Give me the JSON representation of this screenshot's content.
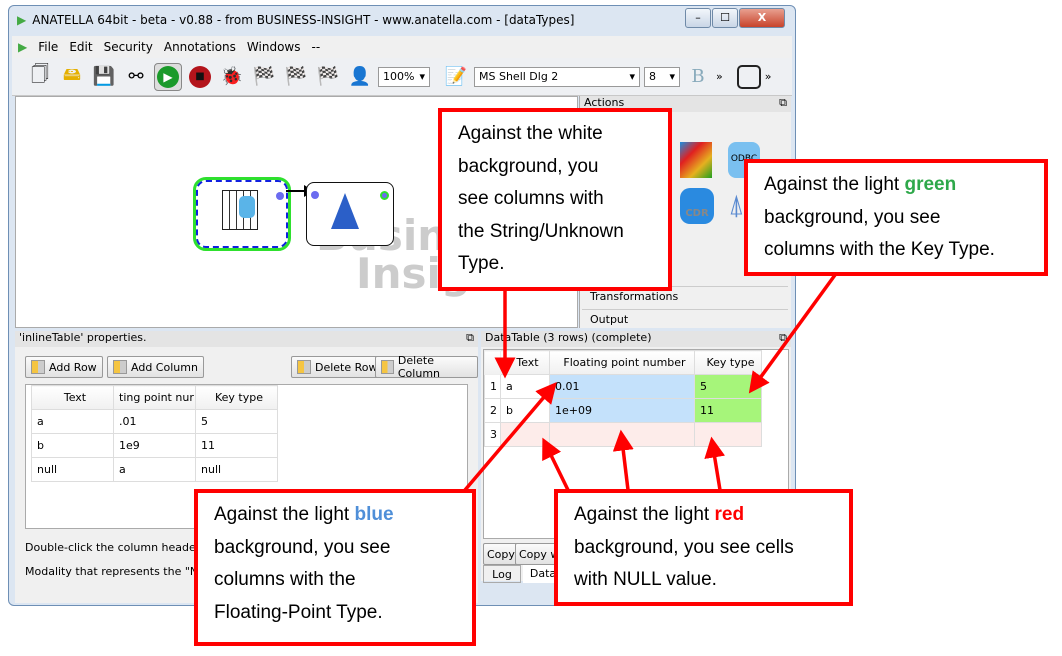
{
  "window": {
    "title": "ANATELLA 64bit - beta - v0.88 - from BUSINESS-INSIGHT - www.anatella.com - [dataTypes]",
    "minimize": "–",
    "maximize": "☐",
    "close": "X"
  },
  "menu": [
    "File",
    "Edit",
    "Security",
    "Annotations",
    "Windows",
    "--"
  ],
  "toolbar": {
    "zoom": "100%",
    "font": "MS Shell Dlg 2",
    "font_size": "8",
    "bold": "B",
    "more": "»"
  },
  "canvas": {
    "watermark_line1": "Business",
    "watermark_line2": "Insight"
  },
  "actions": {
    "title": "Actions",
    "icon_odbc": "ODBC",
    "icon_cdr": "CDR",
    "item_transformations": "Transformations",
    "item_output": "Output"
  },
  "properties": {
    "title": "'inlineTable' properties.",
    "add_row": "Add Row",
    "add_column": "Add Column",
    "delete_row": "Delete Row",
    "delete_column": "Delete Column",
    "columns": [
      "Text",
      "ting point nur",
      "Key type"
    ],
    "rows": [
      [
        "a",
        ".01",
        "5"
      ],
      [
        "b",
        "1e9",
        "11"
      ],
      [
        "null",
        "a",
        "null"
      ]
    ],
    "hint": "Double-click the column header to ch",
    "null_label": "Modality that represents the \"NULL\":"
  },
  "datatable": {
    "title": "DataTable (3 rows) (complete)",
    "columns": [
      "Text",
      "Floating point number",
      "Key type"
    ],
    "rows": [
      {
        "n": "1",
        "text": "a",
        "float": "0.01",
        "key": "5"
      },
      {
        "n": "2",
        "text": "b",
        "float": "1e+09",
        "key": "11"
      },
      {
        "n": "3",
        "text": "",
        "float": "",
        "key": ""
      }
    ],
    "copy": "Copy",
    "copy_with": "Copy wi",
    "tab_log": "Log",
    "tab_data": "Data"
  },
  "colors": {
    "float_bg": "#c4e1fb",
    "key_bg": "#a6f57a",
    "null_bg": "#fdecea",
    "callout_border": "#ff0000",
    "blue_word": "#4f8fd8",
    "green_word": "#2ea84a",
    "red_word": "#ff0000"
  },
  "callouts": {
    "white": [
      "Against the white",
      "background, you",
      "see columns with",
      "the String/Unknown",
      "Type."
    ],
    "green": {
      "pre": "Against the light ",
      "word": "green",
      "lines": [
        "background, you see",
        "columns with the Key Type."
      ]
    },
    "blue": {
      "pre": "Against the light ",
      "word": "blue",
      "lines": [
        "background, you see",
        "columns with the",
        "Floating-Point Type."
      ]
    },
    "red": {
      "pre": "Against the light ",
      "word": "red",
      "lines": [
        "background, you see cells",
        "with NULL value."
      ]
    }
  }
}
